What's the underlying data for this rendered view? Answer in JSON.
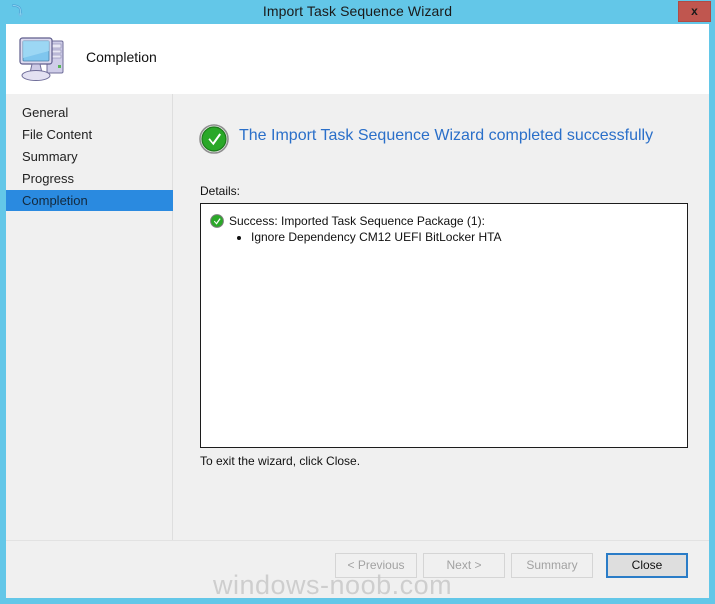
{
  "window": {
    "title": "Import Task Sequence Wizard",
    "titlebar_icon": "import-arrow-icon",
    "close_label": "x",
    "titlebar_color": "#63c7e8",
    "accent_color": "#2a8ae0"
  },
  "header": {
    "icon": "computer-icon",
    "title": "Completion"
  },
  "sidebar": {
    "items": [
      {
        "label": "General",
        "selected": false
      },
      {
        "label": "File Content",
        "selected": false
      },
      {
        "label": "Summary",
        "selected": false
      },
      {
        "label": "Progress",
        "selected": false
      },
      {
        "label": "Completion",
        "selected": true
      }
    ]
  },
  "content": {
    "result_icon": "success-check-icon",
    "result_text": "The Import Task Sequence Wizard completed successfully",
    "result_text_color": "#2a6fc9",
    "details_label": "Details:",
    "details": {
      "status_icon": "success-check-icon",
      "status_text": "Success: Imported Task Sequence Package (1):",
      "items": [
        "Ignore Dependency CM12 UEFI BitLocker HTA"
      ]
    },
    "exit_note": "To exit the wizard, click Close."
  },
  "footer": {
    "buttons": [
      {
        "label": "< Previous",
        "state": "disabled"
      },
      {
        "label": "Next >",
        "state": "disabled"
      },
      {
        "label": "Summary",
        "state": "disabled"
      },
      {
        "label": "Close",
        "state": "default-focused"
      }
    ]
  },
  "watermark": {
    "text": "windows-noob.com"
  }
}
